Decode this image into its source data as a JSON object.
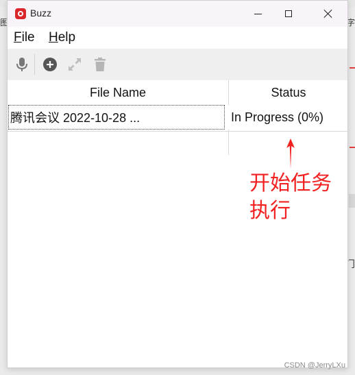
{
  "background": {
    "left_char": "图",
    "right_char": "字",
    "right_glyph": "门"
  },
  "window": {
    "title": "Buzz",
    "menu": [
      {
        "label": "File",
        "mnemonic": "F",
        "rest": "ile"
      },
      {
        "label": "Help",
        "mnemonic": "H",
        "rest": "elp"
      }
    ],
    "toolbar_icons": [
      "microphone-icon",
      "add-icon",
      "expand-icon",
      "trash-icon"
    ]
  },
  "table": {
    "headers": {
      "file_name": "File Name",
      "status": "Status"
    },
    "rows": [
      {
        "file_name": "腾讯会议 2022-10-28 ...",
        "status": "In Progress (0%)"
      }
    ]
  },
  "annotation": {
    "text": "开始任务执行",
    "color": "#f22020"
  },
  "watermark": "CSDN @JerryLXu",
  "colors": {
    "app_icon": "#d9262a",
    "titlebar": "#f9f4f9",
    "toolbar": "#efefef"
  }
}
